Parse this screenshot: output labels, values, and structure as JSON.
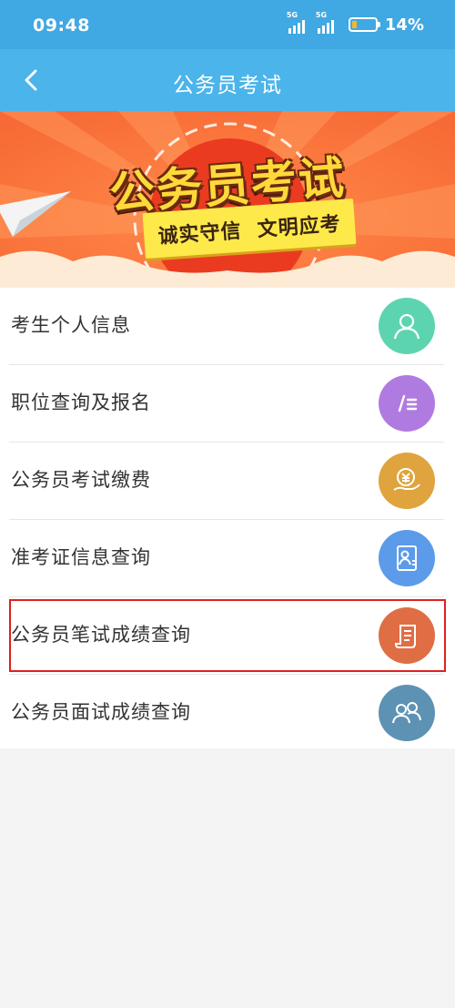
{
  "status": {
    "time": "09:48",
    "network1": "5G",
    "network2": "5G",
    "battery": "14%"
  },
  "header": {
    "title": "公务员考试"
  },
  "banner": {
    "title": "公务员考试",
    "slogan": "诚实守信  文明应考"
  },
  "menu": {
    "items": [
      {
        "label": "考生个人信息",
        "icon": "person-icon",
        "color": "#5dd4b0"
      },
      {
        "label": "职位查询及报名",
        "icon": "edit-list-icon",
        "color": "#b07be0"
      },
      {
        "label": "公务员考试缴费",
        "icon": "yuan-payment-icon",
        "color": "#dfa43e"
      },
      {
        "label": "准考证信息查询",
        "icon": "id-card-icon",
        "color": "#5b9bea"
      },
      {
        "label": "公务员笔试成绩查询",
        "icon": "document-scroll-icon",
        "color": "#df6e45"
      },
      {
        "label": "公务员面试成绩查询",
        "icon": "interview-people-icon",
        "color": "#5d92b4"
      }
    ]
  },
  "colors": {
    "statusbar": "#40a8e2",
    "navbar": "#4bb4ea",
    "highlight": "#e01f1f"
  }
}
